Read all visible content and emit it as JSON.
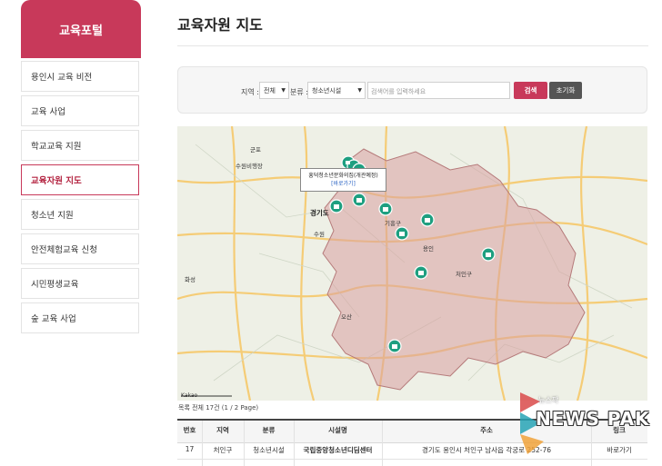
{
  "sidebar": {
    "title": "교육포털",
    "items": [
      {
        "label": "용인시 교육 비전"
      },
      {
        "label": "교육 사업"
      },
      {
        "label": "학교교육 지원"
      },
      {
        "label": "교육자원 지도"
      },
      {
        "label": "청소년 지원"
      },
      {
        "label": "안전체험교육 신청"
      },
      {
        "label": "시민평생교육"
      },
      {
        "label": "숲 교육 사업"
      }
    ],
    "active_item": "교육자원 지도"
  },
  "page_title": "교육자원 지도",
  "search": {
    "region_label": "지역 :",
    "region_value": "전체",
    "category_label": "분류 :",
    "category_value": "청소년시설",
    "placeholder": "검색어를 입력하세요",
    "search_button": "검색",
    "reset_button": "초기화"
  },
  "map": {
    "popup_title": "흥덕청소년문화의집(개관예정)",
    "popup_link": "[바로가기]",
    "labels": {
      "gunpo": "군포",
      "suwon_airbase": "수원비행장",
      "gyeonggi_do": "경기도",
      "suwon": "수원",
      "hwaseong": "화성",
      "osan": "오산",
      "giheung": "기흥구",
      "cheoin": "처인구",
      "yongin": "용인"
    },
    "copyright": "Kakao",
    "marker_color": "#1e9f80",
    "region_fill": "#d9a0a0"
  },
  "result_summary": "목록 전체 17건 (1 / 2 Page)",
  "table": {
    "headers": [
      "번호",
      "지역",
      "분류",
      "시설명",
      "주소",
      "링크"
    ],
    "rows": [
      [
        "17",
        "처인구",
        "청소년시설",
        "국립중앙청소년디딤센터",
        "경기도 용인시 처인구 남사읍 각궁로 252-76",
        "바로가기"
      ]
    ]
  },
  "watermark": {
    "small": "뉴스팍",
    "big": "NEWS PAK"
  }
}
